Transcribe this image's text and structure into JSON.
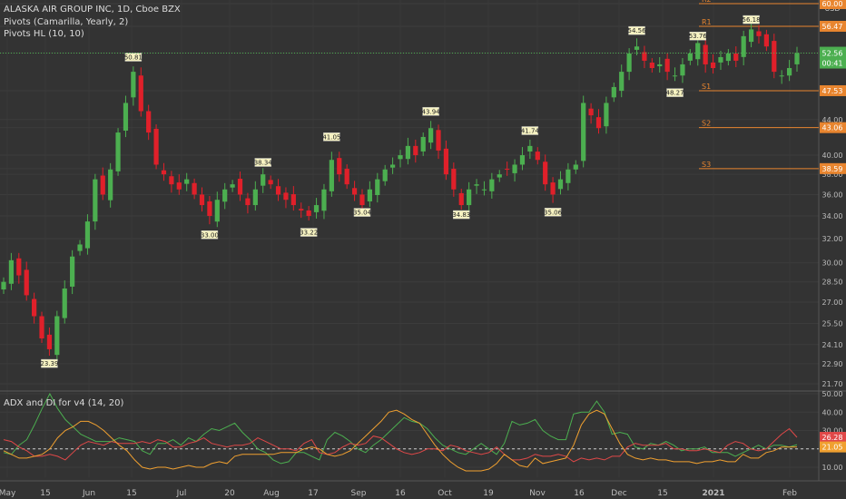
{
  "header": {
    "symbol_title": "ALASKA AIR GROUP INC, 1D, Cboe BZX",
    "indicator_1": "Pivots (Camarilla, Yearly, 2)",
    "indicator_2": "Pivots HL (10, 10)",
    "currency": "USD"
  },
  "subpane": {
    "title": "ADX and DI for v4 (14, 20)"
  },
  "colors": {
    "background": "#333333",
    "up_candle": "#4caf50",
    "down_candle": "#e0202a",
    "pivot_level": "#e8852f",
    "di_plus": "#4caf50",
    "di_minus": "#e04848",
    "adx": "#f0a030",
    "label_bg": "#f7f3c2"
  },
  "chart_data": [
    {
      "type": "candlestick",
      "title": "ALASKA AIR GROUP INC, 1D, Cboe BZX",
      "y_axis_ticks": [
        "60.00",
        "56.47",
        "52.56",
        "47.53",
        "44.00",
        "43.06",
        "40.00",
        "38.59",
        "38.00",
        "36.00",
        "34.00",
        "32.00",
        "30.00",
        "28.50",
        "27.00",
        "25.50",
        "24.10",
        "22.90",
        "21.70"
      ],
      "y_axis_scale": "log",
      "ylim": [
        21.0,
        61.0
      ],
      "x_axis_ticks": [
        "May",
        "15",
        "Jun",
        "15",
        "Jul",
        "20",
        "Aug",
        "17",
        "Sep",
        "16",
        "Oct",
        "19",
        "Nov",
        "16",
        "Dec",
        "15",
        "2021",
        "Feb"
      ],
      "last_price": "52.56",
      "countdown": "00:41",
      "close_series": [
        {
          "x": "May",
          "y": 28.5
        },
        {
          "x": "May",
          "y": 30.2
        },
        {
          "x": "May",
          "y": 29.0
        },
        {
          "x": "May",
          "y": 27.5
        },
        {
          "x": "May",
          "y": 26.0
        },
        {
          "x": "15",
          "y": 24.5
        },
        {
          "x": "15",
          "y": 23.8
        },
        {
          "x": "15",
          "y": 26.0
        },
        {
          "x": "15",
          "y": 28.0
        },
        {
          "x": "15",
          "y": 30.5
        },
        {
          "x": "15",
          "y": 31.5
        },
        {
          "x": "15",
          "y": 33.5
        },
        {
          "x": "Jun",
          "y": 37.5
        },
        {
          "x": "Jun",
          "y": 36.0
        },
        {
          "x": "Jun",
          "y": 38.5
        },
        {
          "x": "Jun",
          "y": 42.5
        },
        {
          "x": "Jun",
          "y": 46.0
        },
        {
          "x": "Jun",
          "y": 50.0
        },
        {
          "x": "Jun",
          "y": 45.0
        },
        {
          "x": "Jun",
          "y": 42.5
        },
        {
          "x": "15",
          "y": 39.0
        },
        {
          "x": "15",
          "y": 38.0
        },
        {
          "x": "15",
          "y": 37.0
        },
        {
          "x": "15",
          "y": 36.5
        },
        {
          "x": "15",
          "y": 37.5
        },
        {
          "x": "15",
          "y": 36.0
        },
        {
          "x": "15",
          "y": 35.0
        },
        {
          "x": "15",
          "y": 34.0
        },
        {
          "x": "Jul",
          "y": 35.5
        },
        {
          "x": "Jul",
          "y": 36.5
        },
        {
          "x": "Jul",
          "y": 37.0
        },
        {
          "x": "Jul",
          "y": 36.0
        },
        {
          "x": "Jul",
          "y": 35.0
        },
        {
          "x": "Jul",
          "y": 36.5
        },
        {
          "x": "Jul",
          "y": 38.0
        },
        {
          "x": "20",
          "y": 37.0
        },
        {
          "x": "20",
          "y": 36.0
        },
        {
          "x": "20",
          "y": 35.5
        },
        {
          "x": "20",
          "y": 35.0
        },
        {
          "x": "20",
          "y": 34.5
        },
        {
          "x": "20",
          "y": 34.0
        },
        {
          "x": "Aug",
          "y": 35.0
        },
        {
          "x": "Aug",
          "y": 36.5
        },
        {
          "x": "Aug",
          "y": 39.5
        },
        {
          "x": "Aug",
          "y": 38.0
        },
        {
          "x": "Aug",
          "y": 37.0
        },
        {
          "x": "17",
          "y": 36.0
        },
        {
          "x": "17",
          "y": 35.0
        },
        {
          "x": "17",
          "y": 36.5
        },
        {
          "x": "17",
          "y": 37.5
        },
        {
          "x": "17",
          "y": 38.5
        },
        {
          "x": "Sep",
          "y": 39.0
        },
        {
          "x": "Sep",
          "y": 40.0
        },
        {
          "x": "Sep",
          "y": 41.0
        },
        {
          "x": "Sep",
          "y": 40.0
        },
        {
          "x": "Sep",
          "y": 42.0
        },
        {
          "x": "16",
          "y": 43.0
        },
        {
          "x": "16",
          "y": 40.5
        },
        {
          "x": "16",
          "y": 38.0
        },
        {
          "x": "16",
          "y": 36.5
        },
        {
          "x": "16",
          "y": 35.0
        },
        {
          "x": "16",
          "y": 36.5
        },
        {
          "x": "Oct",
          "y": 37.0
        },
        {
          "x": "Oct",
          "y": 36.5
        },
        {
          "x": "Oct",
          "y": 37.5
        },
        {
          "x": "Oct",
          "y": 38.0
        },
        {
          "x": "Oct",
          "y": 38.5
        },
        {
          "x": "19",
          "y": 39.0
        },
        {
          "x": "19",
          "y": 40.0
        },
        {
          "x": "19",
          "y": 41.0
        },
        {
          "x": "19",
          "y": 39.5
        },
        {
          "x": "19",
          "y": 37.0
        },
        {
          "x": "19",
          "y": 36.0
        },
        {
          "x": "Nov",
          "y": 37.5
        },
        {
          "x": "Nov",
          "y": 38.5
        },
        {
          "x": "Nov",
          "y": 39.0
        },
        {
          "x": "16",
          "y": 46.0
        },
        {
          "x": "16",
          "y": 44.5
        },
        {
          "x": "16",
          "y": 43.0
        },
        {
          "x": "16",
          "y": 46.0
        },
        {
          "x": "16",
          "y": 48.0
        },
        {
          "x": "16",
          "y": 50.0
        },
        {
          "x": "Dec",
          "y": 52.5
        },
        {
          "x": "Dec",
          "y": 53.5
        },
        {
          "x": "Dec",
          "y": 51.5
        },
        {
          "x": "Dec",
          "y": 50.5
        },
        {
          "x": "Dec",
          "y": 51.0
        },
        {
          "x": "15",
          "y": 50.0
        },
        {
          "x": "15",
          "y": 49.5
        },
        {
          "x": "15",
          "y": 51.0
        },
        {
          "x": "15",
          "y": 52.5
        },
        {
          "x": "15",
          "y": 54.0
        },
        {
          "x": "15",
          "y": 51.0
        },
        {
          "x": "2021",
          "y": 50.5
        },
        {
          "x": "2021",
          "y": 52.0
        },
        {
          "x": "2021",
          "y": 52.5
        },
        {
          "x": "2021",
          "y": 51.5
        },
        {
          "x": "2021",
          "y": 55.0
        },
        {
          "x": "2021",
          "y": 56.0
        },
        {
          "x": "2021",
          "y": 55.0
        },
        {
          "x": "2021",
          "y": 53.5
        },
        {
          "x": "Feb",
          "y": 50.0
        },
        {
          "x": "Feb",
          "y": 49.5
        },
        {
          "x": "Feb",
          "y": 50.5
        },
        {
          "x": "Feb",
          "y": 52.56
        }
      ],
      "pivot_levels": [
        {
          "name": "R2",
          "value": 60.0,
          "axis_label": "60.00"
        },
        {
          "name": "R1",
          "value": 56.47,
          "axis_label": "56.47"
        },
        {
          "name": "S1",
          "value": 47.53,
          "axis_label": "47.53"
        },
        {
          "name": "S2",
          "value": 43.06,
          "axis_label": "43.06"
        },
        {
          "name": "S3",
          "value": 38.59,
          "axis_label": "38.59"
        }
      ],
      "pivot_hl_labels": [
        {
          "text": "23.39",
          "kind": "low",
          "index": 6,
          "value": 23.39
        },
        {
          "text": "50.81",
          "kind": "high",
          "index": 17,
          "value": 50.81
        },
        {
          "text": "33.00",
          "kind": "low",
          "index": 27,
          "value": 33.0
        },
        {
          "text": "38.34",
          "kind": "high",
          "index": 34,
          "value": 38.34
        },
        {
          "text": "33.22",
          "kind": "low",
          "index": 40,
          "value": 33.22
        },
        {
          "text": "41.05",
          "kind": "high",
          "index": 43,
          "value": 41.05
        },
        {
          "text": "35.04",
          "kind": "low",
          "index": 47,
          "value": 35.04
        },
        {
          "text": "43.94",
          "kind": "high",
          "index": 56,
          "value": 43.94
        },
        {
          "text": "34.83",
          "kind": "low",
          "index": 60,
          "value": 34.83
        },
        {
          "text": "41.74",
          "kind": "high",
          "index": 69,
          "value": 41.74
        },
        {
          "text": "35.06",
          "kind": "low",
          "index": 72,
          "value": 35.06
        },
        {
          "text": "54.56",
          "kind": "high",
          "index": 83,
          "value": 54.56
        },
        {
          "text": "48.27",
          "kind": "low",
          "index": 88,
          "value": 48.27
        },
        {
          "text": "53.76",
          "kind": "high",
          "index": 91,
          "value": 53.76
        },
        {
          "text": "56.18",
          "kind": "high",
          "index": 98,
          "value": 56.18
        }
      ]
    },
    {
      "type": "line",
      "title": "ADX and DI for v4 (14, 20)",
      "y_axis_ticks": [
        "50.00",
        "40.00",
        "30.00",
        "20.00",
        "10.00"
      ],
      "ylim": [
        4,
        51
      ],
      "threshold": 20,
      "series": [
        {
          "name": "DI+",
          "color": "#4caf50",
          "last": "22.30",
          "values": [
            18,
            17,
            22,
            25,
            33,
            42,
            50,
            42,
            36,
            32,
            28,
            26,
            24,
            24,
            24,
            26,
            25,
            24,
            19,
            17,
            23,
            23,
            25,
            22,
            26,
            24,
            28,
            31,
            30,
            32,
            34,
            29,
            25,
            20,
            18,
            14,
            12,
            13,
            18,
            18,
            16,
            14,
            25,
            29,
            27,
            24,
            20,
            18,
            22,
            25,
            29,
            33,
            37,
            35,
            34,
            31,
            26,
            22,
            20,
            18,
            17,
            20,
            23,
            20,
            17,
            23,
            35,
            33,
            34,
            36,
            30,
            27,
            25,
            25,
            39,
            40,
            40,
            46,
            40,
            28,
            29,
            28,
            21,
            20,
            23,
            22,
            24,
            22,
            19,
            20,
            20,
            21,
            18,
            18,
            18,
            16,
            18,
            20,
            22,
            20,
            22,
            22,
            21,
            22.3
          ]
        },
        {
          "name": "DI-",
          "color": "#e04848",
          "last": "26.28",
          "values": [
            25,
            24,
            21,
            19,
            16,
            16,
            17,
            16,
            14,
            18,
            22,
            24,
            23,
            22,
            24,
            23,
            23,
            23,
            24,
            23,
            25,
            24,
            21,
            21,
            23,
            24,
            26,
            23,
            22,
            21,
            22,
            22,
            23,
            26,
            24,
            22,
            20,
            20,
            19,
            23,
            25,
            18,
            17,
            18,
            21,
            23,
            22,
            23,
            27,
            26,
            23,
            20,
            18,
            17,
            18,
            20,
            20,
            19,
            22,
            21,
            19,
            18,
            17,
            18,
            21,
            17,
            14,
            14,
            15,
            17,
            16,
            16,
            17,
            16,
            13,
            15,
            14,
            15,
            14,
            16,
            16,
            21,
            23,
            22,
            22,
            22,
            23,
            20,
            20,
            19,
            19,
            20,
            19,
            18,
            22,
            24,
            23,
            20,
            19,
            20,
            24,
            28,
            31,
            26.28
          ]
        },
        {
          "name": "ADX",
          "color": "#f0a030",
          "last": "21.05",
          "values": [
            19,
            17,
            15,
            15,
            16,
            17,
            20,
            26,
            30,
            32,
            35,
            35,
            33,
            30,
            26,
            22,
            19,
            14,
            10,
            9,
            10,
            10,
            9,
            10,
            11,
            10,
            10,
            12,
            13,
            12,
            16,
            17,
            17,
            17,
            17,
            17,
            18,
            18,
            18,
            20,
            21,
            20,
            17,
            16,
            17,
            19,
            23,
            27,
            31,
            35,
            40,
            41,
            39,
            36,
            34,
            28,
            22,
            17,
            13,
            10,
            8,
            8,
            8,
            9,
            12,
            17,
            14,
            11,
            10,
            15,
            12,
            13,
            14,
            15,
            22,
            33,
            39,
            41,
            39,
            31,
            23,
            17,
            15,
            14,
            15,
            14,
            14,
            13,
            13,
            13,
            12,
            13,
            13,
            14,
            13,
            13,
            17,
            15,
            15,
            18,
            19,
            21,
            21,
            21.05
          ]
        }
      ]
    }
  ]
}
